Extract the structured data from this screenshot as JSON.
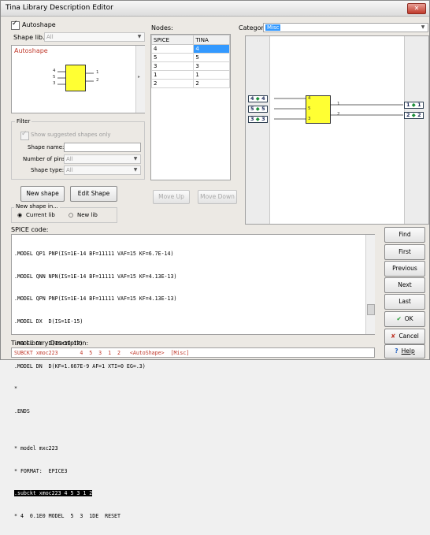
{
  "window": {
    "title": "Tina Library Description Editor",
    "close_glyph": "✕"
  },
  "autoshape": {
    "label": "Autoshape",
    "checked": true
  },
  "shape_lib": {
    "label": "Shape lib.",
    "value": "All"
  },
  "preview": {
    "caption": "Autoshape",
    "left_pins": [
      "4",
      "5",
      "3"
    ],
    "right_pins": [
      "1",
      "2"
    ]
  },
  "filter": {
    "title": "Filter",
    "show_suggested": "Show suggested shapes only",
    "shape_name_label": "Shape name:",
    "shape_name_value": "",
    "num_pins_label": "Number of pins:",
    "num_pins_value": "All",
    "shape_type_label": "Shape type:",
    "shape_type_value": "All"
  },
  "buttons": {
    "new_shape": "New shape",
    "edit_shape": "Edit Shape",
    "move_up": "Move Up",
    "move_down": "Move Down",
    "find": "Find",
    "first": "First",
    "previous": "Previous",
    "next": "Next",
    "last": "Last",
    "ok": "OK",
    "cancel": "Cancel",
    "help": "Help"
  },
  "new_shape_in": {
    "title": "New shape in...",
    "current_lib": "Current lib",
    "new_lib": "New lib",
    "selected": "current_lib"
  },
  "nodes": {
    "label": "Nodes:",
    "headers": [
      "SPICE",
      "TINA"
    ],
    "rows": [
      [
        "4",
        "4"
      ],
      [
        "5",
        "5"
      ],
      [
        "3",
        "3"
      ],
      [
        "1",
        "1"
      ],
      [
        "2",
        "2"
      ]
    ]
  },
  "category": {
    "label": "Category",
    "value": "Misc"
  },
  "schematic": {
    "left_ports": [
      "4",
      "5",
      "3"
    ],
    "right_ports": [
      "1",
      "2"
    ],
    "chip_left_pins": [
      "4",
      "5",
      "3"
    ],
    "chip_right_pins": [
      "1",
      "2"
    ],
    "port_glyph": "◆"
  },
  "spice": {
    "label": "SPICE code:",
    "lines": [
      ".MODEL QP1 PNP(IS=1E-14 BF=11111 VAF=15 KF=6.7E-14)",
      ".MODEL QNN NPN(IS=1E-14 BF=11111 VAF=15 KF=4.13E-13)",
      ".MODEL QPN PNP(IS=1E-14 BF=11111 VAF=15 KF=4.13E-13)",
      ".MODEL DX  D(IS=1E-15)",
      ".MODEL DY  D(IS=1E-17)",
      ".MODEL DN  D(KF=1.667E-9 AF=1 XTI=0 EG=.3)",
      "*",
      ".ENDS",
      "",
      "* model mxc223",
      "* FORMAT:  EPICE3",
      ".subckt xmoc223 4 5 3 1 2",
      "* 4  0.1E0 MODEL  5  3  1DE  RESET"
    ],
    "highlight_index": 11
  },
  "tina_desc": {
    "label": "Tina Library Description:",
    "text": "SUBCKT xmoc223       4  5  3  1  2   <AutoShape>  [Misc]"
  },
  "icons": {
    "ok": "✔",
    "cancel": "✘",
    "help": "?"
  },
  "colors": {
    "chip": "#ffff33",
    "selection": "#3399ff",
    "desc_text": "#c0392b"
  }
}
